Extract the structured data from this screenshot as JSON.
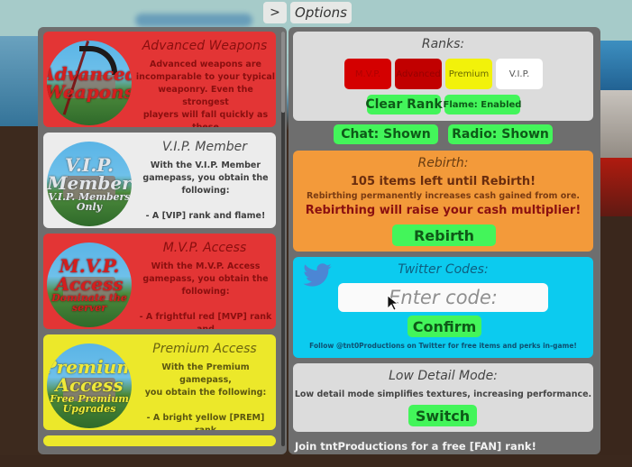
{
  "top_tabs": {
    "toggle_label": ">",
    "options_label": "Options"
  },
  "gamepasses": [
    {
      "title": "Advanced Weapons",
      "icon_lines": [
        "Advanced",
        "Weapons"
      ],
      "description": "Advanced weapons are\nincomparable to your typical\nweaponry. Even the strongest\nplayers will fall quickly as these\nare, by far, the most powerful",
      "color": "#e33535"
    },
    {
      "title": "V.I.P. Member",
      "icon_lines": [
        "V.I.P.",
        "Member",
        "V.I.P. Members",
        "Only"
      ],
      "description": "With the V.I.P. Member\ngamepass, you obtain the\nfollowing:\n\n- A [VIP] rank and flame!",
      "color": "#ececec"
    },
    {
      "title": "M.V.P. Access",
      "icon_lines": [
        "M.V.P.",
        "Access",
        "Dominate the",
        "server"
      ],
      "description": "With the M.V.P. Access\ngamepass, you obtain the\nfollowing:\n\n- A frightful red [MVP] rank and",
      "color": "#e33535"
    },
    {
      "title": "Premium Access",
      "icon_lines": [
        "Premium",
        "Access",
        "Free Premium",
        "Upgrades"
      ],
      "description": "With the Premium gamepass,\nyou obtain the following:\n\n- A bright yellow [PREM] rank\nand flame!",
      "color": "#ece82a"
    }
  ],
  "ranks": {
    "title": "Ranks:",
    "chips": [
      {
        "label": "M.V.P.",
        "bg": "#d40000",
        "fg": "#b00000"
      },
      {
        "label": "Advanced",
        "bg": "#c10000",
        "fg": "#960000"
      },
      {
        "label": "Premium",
        "bg": "#f2f20a",
        "fg": "#6a6a00"
      },
      {
        "label": "V.I.P.",
        "bg": "#ffffff",
        "fg": "#555555"
      }
    ],
    "clear_rank_label": "Clear Rank",
    "flame_label": "Flame: Enabled"
  },
  "toggles": {
    "chat_label": "Chat: Shown",
    "radio_label": "Radio: Shown"
  },
  "rebirth": {
    "title": "Rebirth:",
    "items_left": "105 items left until Rebirth!",
    "info": "Rebirthing permanently increases cash gained from ore.",
    "multiplier_note": "Rebirthing will raise your cash multiplier!",
    "button_label": "Rebirth"
  },
  "twitter": {
    "title": "Twitter Codes:",
    "code_value": "",
    "code_placeholder": "Enter code:",
    "confirm_label": "Confirm",
    "follow_text": "Follow @tnt0Productions on Twitter for free items and perks in-game!"
  },
  "low_detail": {
    "title": "Low Detail Mode:",
    "description": "Low detail mode simplifies textures, increasing performance.",
    "button_label": "Switch"
  },
  "footer": {
    "text": "Join tntProductions for a free [FAN] rank!"
  },
  "colors": {
    "green_button": "#43f55a",
    "panel_gray": "#6e6e6e",
    "rebirth_orange": "#f39a3a",
    "twitter_cyan": "#0ccbef"
  }
}
